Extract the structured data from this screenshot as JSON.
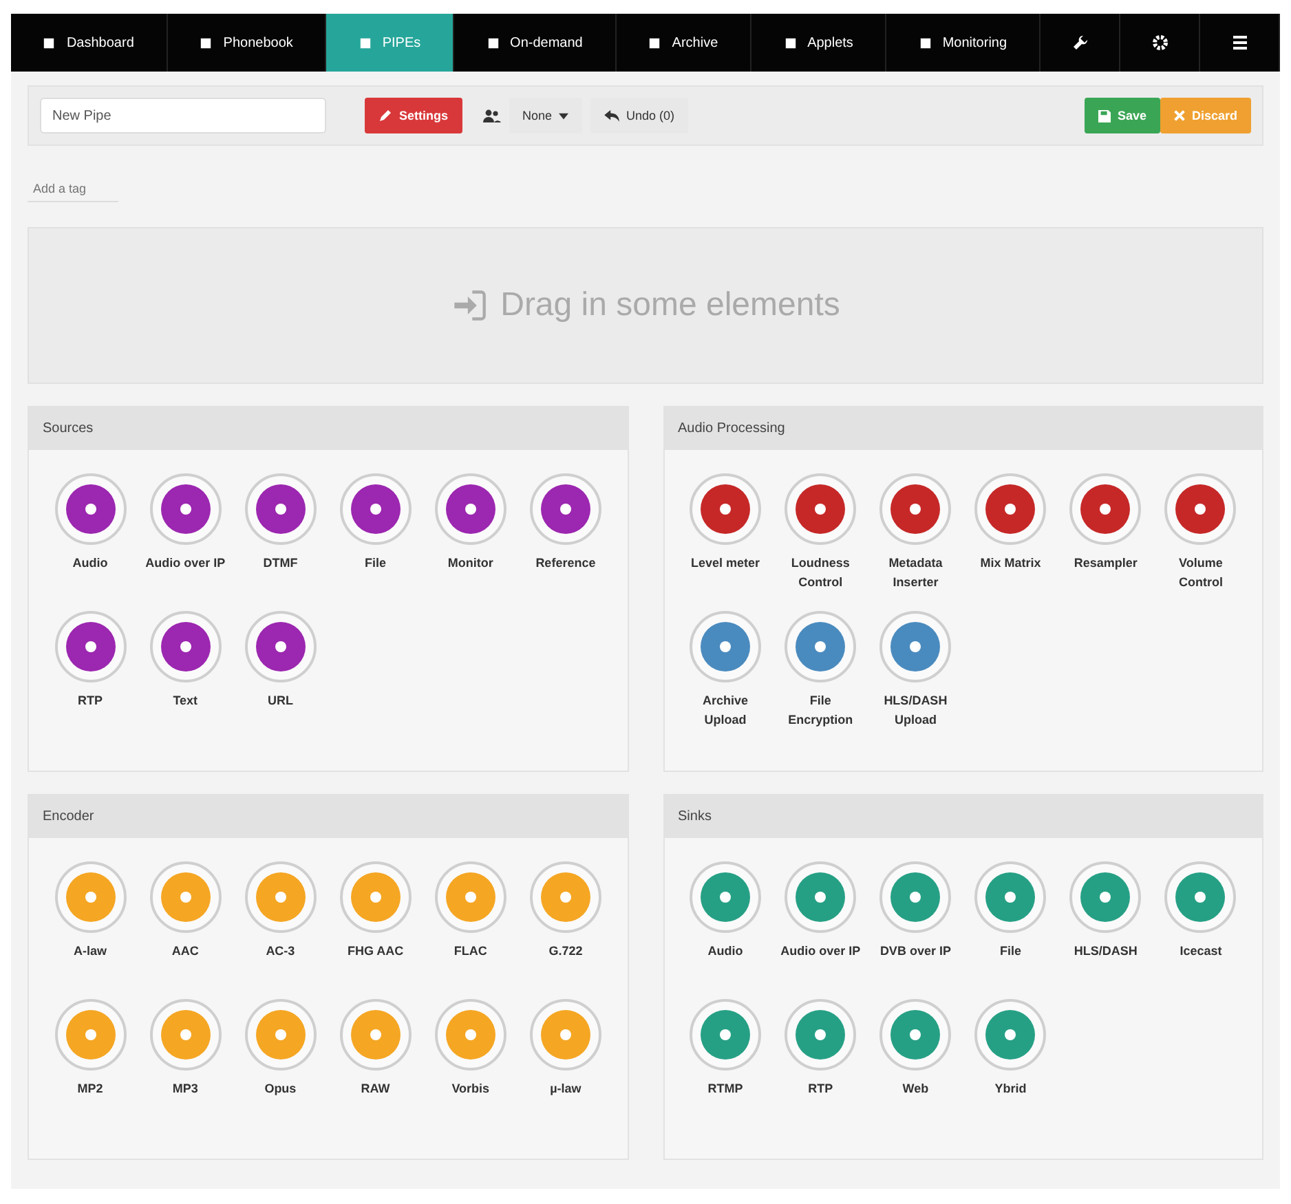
{
  "nav": {
    "tabs": [
      {
        "label": "Dashboard",
        "selected": false
      },
      {
        "label": "Phonebook",
        "selected": false
      },
      {
        "label": "PIPEs",
        "selected": true
      },
      {
        "label": "On-demand",
        "selected": false
      },
      {
        "label": "Archive",
        "selected": false
      },
      {
        "label": "Applets",
        "selected": false
      },
      {
        "label": "Monitoring",
        "selected": false
      }
    ],
    "icon_tabs": [
      {
        "kind": "wrench",
        "selected": false
      },
      {
        "kind": "gear",
        "selected": false
      },
      {
        "kind": "list",
        "selected": false
      }
    ]
  },
  "toolbar": {
    "name_field": {
      "value": "New Pipe"
    },
    "settings_button": "Settings",
    "group_dropdown": "None",
    "undo_button": "Undo (0)",
    "save_button": "Save",
    "discard_button": "Discard"
  },
  "tag_field": {
    "placeholder": "Add a tag"
  },
  "drop_zone": {
    "text": "Drag in some elements"
  },
  "groups": [
    {
      "title": "Sources",
      "color": "#9c27b0",
      "items": [
        {
          "label": "Audio"
        },
        {
          "label": "Audio over IP"
        },
        {
          "label": "DTMF"
        },
        {
          "label": "File"
        },
        {
          "label": "Monitor"
        },
        {
          "label": "Reference"
        },
        {
          "label": "RTP"
        },
        {
          "label": "Text"
        },
        {
          "label": "URL"
        }
      ]
    },
    {
      "title": "Audio Processing",
      "items": [
        {
          "label": "Level meter",
          "color": "#c62828"
        },
        {
          "label": "Loudness Control",
          "color": "#c62828"
        },
        {
          "label": "Metadata Inserter",
          "color": "#c62828"
        },
        {
          "label": "Mix Matrix",
          "color": "#c62828"
        },
        {
          "label": "Resampler",
          "color": "#c62828"
        },
        {
          "label": "Volume Control",
          "color": "#c62828"
        },
        {
          "label": "Archive Upload",
          "color": "#4a8bbf"
        },
        {
          "label": "File Encryption",
          "color": "#4a8bbf"
        },
        {
          "label": "HLS/DASH Upload",
          "color": "#4a8bbf"
        }
      ]
    },
    {
      "title": "Encoder",
      "color": "#f5a623",
      "items": [
        {
          "label": "A-law"
        },
        {
          "label": "AAC"
        },
        {
          "label": "AC-3"
        },
        {
          "label": "FHG AAC"
        },
        {
          "label": "FLAC"
        },
        {
          "label": "G.722"
        },
        {
          "label": "MP2"
        },
        {
          "label": "MP3"
        },
        {
          "label": "Opus"
        },
        {
          "label": "RAW"
        },
        {
          "label": "Vorbis"
        },
        {
          "label": "µ-law"
        }
      ]
    },
    {
      "title": "Sinks",
      "color": "#26a085",
      "items": [
        {
          "label": "Audio"
        },
        {
          "label": "Audio over IP"
        },
        {
          "label": "DVB over IP"
        },
        {
          "label": "File"
        },
        {
          "label": "HLS/DASH"
        },
        {
          "label": "Icecast"
        },
        {
          "label": "RTMP"
        },
        {
          "label": "RTP"
        },
        {
          "label": "Web"
        },
        {
          "label": "Ybrid"
        }
      ]
    }
  ]
}
